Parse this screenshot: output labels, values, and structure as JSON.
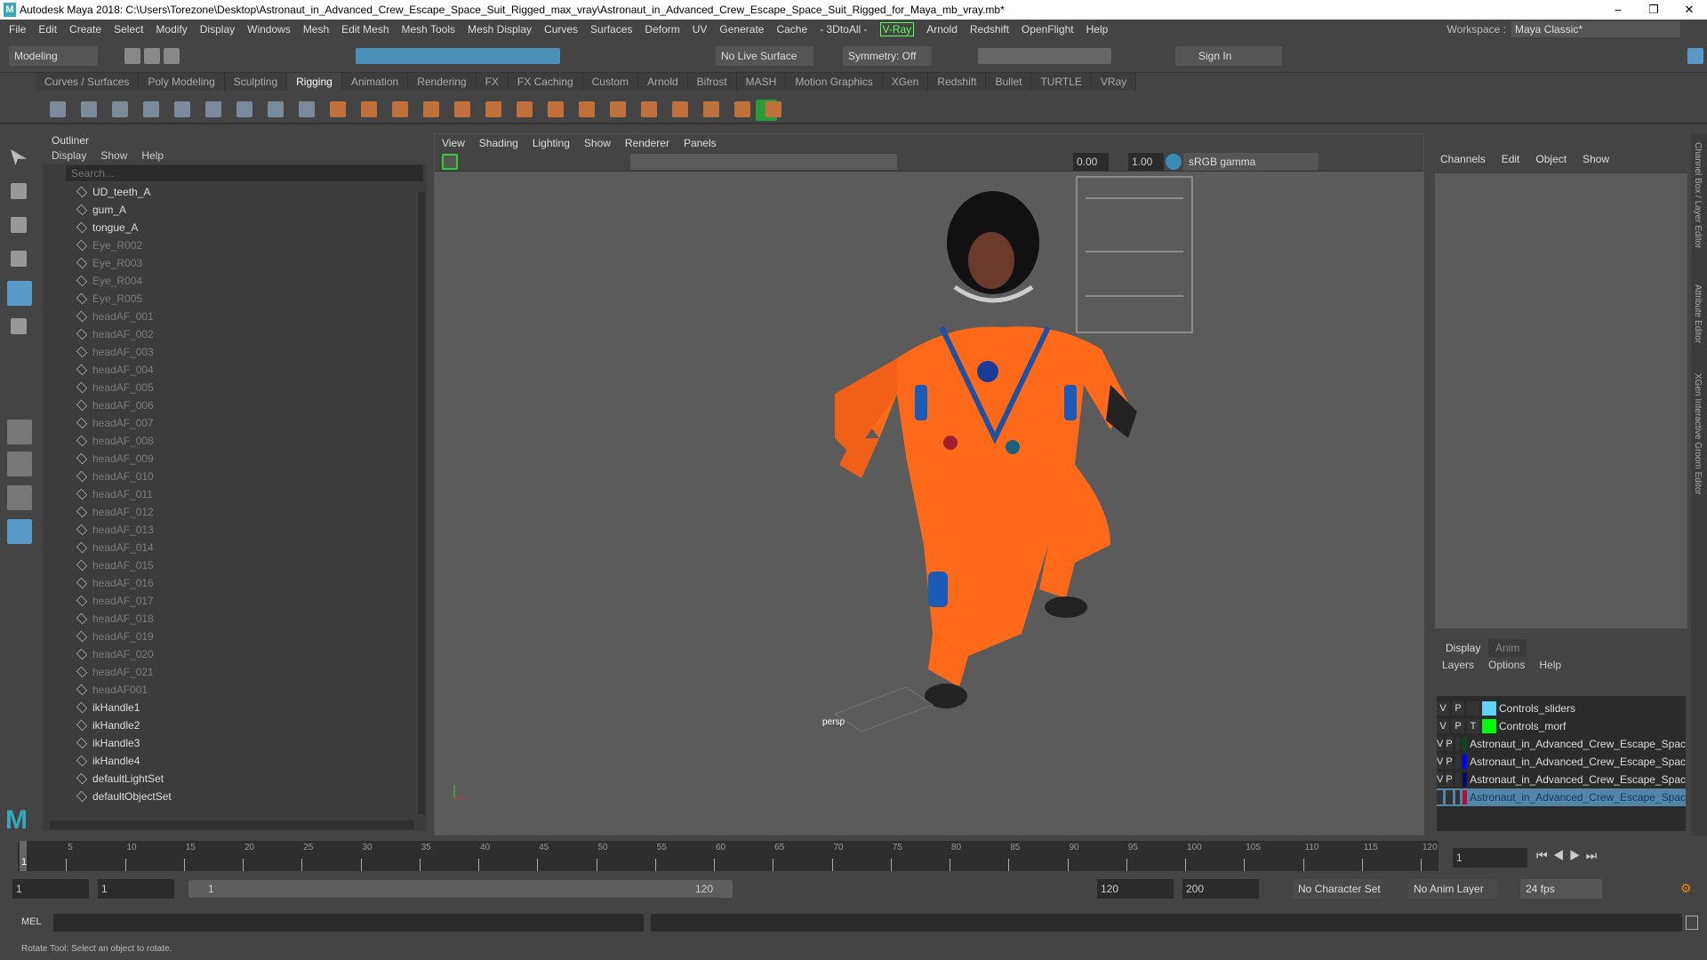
{
  "title": "Autodesk Maya 2018: C:\\Users\\Torezone\\Desktop\\Astronaut_in_Advanced_Crew_Escape_Space_Suit_Rigged_max_vray\\Astronaut_in_Advanced_Crew_Escape_Space_Suit_Rigged_for_Maya_mb_vray.mb*",
  "menus": [
    "File",
    "Edit",
    "Create",
    "Select",
    "Modify",
    "Display",
    "Windows",
    "Mesh",
    "Edit Mesh",
    "Mesh Tools",
    "Mesh Display",
    "Curves",
    "Surfaces",
    "Deform",
    "UV",
    "Generate",
    "Cache",
    "- 3DtoAll -",
    "V-Ray",
    "Arnold",
    "Redshift",
    "OpenFlight",
    "Help"
  ],
  "workspace": {
    "label": "Workspace :",
    "value": "Maya Classic*"
  },
  "status": {
    "mode": "Modeling",
    "live_surface": "No Live Surface",
    "symmetry": "Symmetry: Off",
    "sign_in": "Sign In"
  },
  "shelf_tabs": [
    "Curves / Surfaces",
    "Poly Modeling",
    "Sculpting",
    "Rigging",
    "Animation",
    "Rendering",
    "FX",
    "FX Caching",
    "Custom",
    "Arnold",
    "Bifrost",
    "MASH",
    "Motion Graphics",
    "XGen",
    "Redshift",
    "Bullet",
    "TURTLE",
    "VRay"
  ],
  "active_shelf": "Rigging",
  "outliner": {
    "title": "Outliner",
    "menu": [
      "Display",
      "Show",
      "Help"
    ],
    "search_placeholder": "Search...",
    "items": [
      {
        "name": "UD_teeth_A",
        "dim": false
      },
      {
        "name": "gum_A",
        "dim": false
      },
      {
        "name": "tongue_A",
        "dim": false
      },
      {
        "name": "Eye_R002",
        "dim": true
      },
      {
        "name": "Eye_R003",
        "dim": true
      },
      {
        "name": "Eye_R004",
        "dim": true
      },
      {
        "name": "Eye_R005",
        "dim": true
      },
      {
        "name": "headAF_001",
        "dim": true
      },
      {
        "name": "headAF_002",
        "dim": true
      },
      {
        "name": "headAF_003",
        "dim": true
      },
      {
        "name": "headAF_004",
        "dim": true
      },
      {
        "name": "headAF_005",
        "dim": true
      },
      {
        "name": "headAF_006",
        "dim": true
      },
      {
        "name": "headAF_007",
        "dim": true
      },
      {
        "name": "headAF_008",
        "dim": true
      },
      {
        "name": "headAF_009",
        "dim": true
      },
      {
        "name": "headAF_010",
        "dim": true
      },
      {
        "name": "headAF_011",
        "dim": true
      },
      {
        "name": "headAF_012",
        "dim": true
      },
      {
        "name": "headAF_013",
        "dim": true
      },
      {
        "name": "headAF_014",
        "dim": true
      },
      {
        "name": "headAF_015",
        "dim": true
      },
      {
        "name": "headAF_016",
        "dim": true
      },
      {
        "name": "headAF_017",
        "dim": true
      },
      {
        "name": "headAF_018",
        "dim": true
      },
      {
        "name": "headAF_019",
        "dim": true
      },
      {
        "name": "headAF_020",
        "dim": true
      },
      {
        "name": "headAF_021",
        "dim": true
      },
      {
        "name": "headAF001",
        "dim": true
      },
      {
        "name": "ikHandle1",
        "dim": false
      },
      {
        "name": "ikHandle2",
        "dim": false
      },
      {
        "name": "ikHandle3",
        "dim": false
      },
      {
        "name": "ikHandle4",
        "dim": false
      },
      {
        "name": "defaultLightSet",
        "dim": false
      },
      {
        "name": "defaultObjectSet",
        "dim": false
      }
    ]
  },
  "viewport": {
    "menu": [
      "View",
      "Shading",
      "Lighting",
      "Show",
      "Renderer",
      "Panels"
    ],
    "exposure": "0.00",
    "gamma": "1.00",
    "color_space": "sRGB gamma",
    "camera": "persp"
  },
  "channel_box": {
    "menu": [
      "Channels",
      "Edit",
      "Object",
      "Show"
    ]
  },
  "layer_editor": {
    "tabs": [
      "Display",
      "Anim"
    ],
    "menu": [
      "Layers",
      "Options",
      "Help"
    ],
    "layers": [
      {
        "v": "V",
        "p": "P",
        "t": "",
        "color": "#5fd3f5",
        "name": "Controls_sliders"
      },
      {
        "v": "V",
        "p": "P",
        "t": "T",
        "color": "#00ff00",
        "name": "Controls_morf"
      },
      {
        "v": "V",
        "p": "P",
        "t": "",
        "color": "#0a4a1a",
        "name": "Astronaut_in_Advanced_Crew_Escape_Spac"
      },
      {
        "v": "V",
        "p": "P",
        "t": "",
        "color": "#0000ff",
        "name": "Astronaut_in_Advanced_Crew_Escape_Spac"
      },
      {
        "v": "V",
        "p": "P",
        "t": "",
        "color": "#000a70",
        "name": "Astronaut_in_Advanced_Crew_Escape_Spac"
      },
      {
        "v": "V",
        "p": "P",
        "t": "",
        "color": "#b0103a",
        "name": "Astronaut_in_Advanced_Crew_Escape_Spac"
      }
    ]
  },
  "side_tabs": [
    "Channel Box / Layer Editor",
    "Attribute Editor",
    "XGen Interactive Groom Editor"
  ],
  "timeline": {
    "ticks": [
      "5",
      "10",
      "15",
      "20",
      "25",
      "30",
      "35",
      "40",
      "45",
      "50",
      "55",
      "60",
      "65",
      "70",
      "75",
      "80",
      "85",
      "90",
      "95",
      "100",
      "105",
      "110",
      "115",
      "120"
    ],
    "current_frame": "1",
    "current_field": "1"
  },
  "range": {
    "start": "1",
    "start2": "1",
    "slider_start": "1",
    "slider_end": "120",
    "end": "120",
    "end2": "200",
    "character_set": "No Character Set",
    "anim_layer": "No Anim Layer",
    "fps": "24 fps"
  },
  "mel": {
    "label": "MEL"
  },
  "help_line": "Rotate Tool: Select an object to rotate."
}
